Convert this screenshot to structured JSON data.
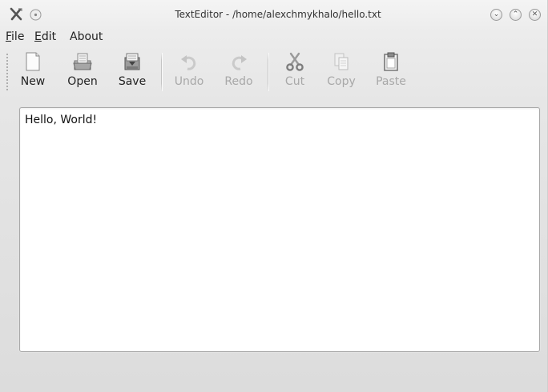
{
  "window": {
    "title": "TextEditor - /home/alexchmykhalo/hello.txt"
  },
  "titlebar": {
    "icons": [
      "app-tools-icon",
      "pin-icon"
    ],
    "buttons": [
      {
        "name": "minimize",
        "glyph": "⌄"
      },
      {
        "name": "maximize",
        "glyph": "⌃"
      },
      {
        "name": "close",
        "glyph": "✕"
      }
    ]
  },
  "menu": {
    "file": {
      "mnemonic": "F",
      "rest": "ile"
    },
    "edit": {
      "mnemonic": "E",
      "rest": "dit"
    },
    "about": {
      "label": "About"
    }
  },
  "toolbar": {
    "new": {
      "label": "New",
      "icon": "new-document-icon",
      "enabled": true
    },
    "open": {
      "label": "Open",
      "icon": "open-folder-icon",
      "enabled": true
    },
    "save": {
      "label": "Save",
      "icon": "save-icon",
      "enabled": true
    },
    "undo": {
      "label": "Undo",
      "icon": "undo-icon",
      "enabled": false
    },
    "redo": {
      "label": "Redo",
      "icon": "redo-icon",
      "enabled": false
    },
    "cut": {
      "label": "Cut",
      "icon": "scissors-icon",
      "enabled": false
    },
    "copy": {
      "label": "Copy",
      "icon": "copy-icon",
      "enabled": false
    },
    "paste": {
      "label": "Paste",
      "icon": "paste-icon",
      "enabled": true
    }
  },
  "editor": {
    "content": "Hello, World!"
  }
}
